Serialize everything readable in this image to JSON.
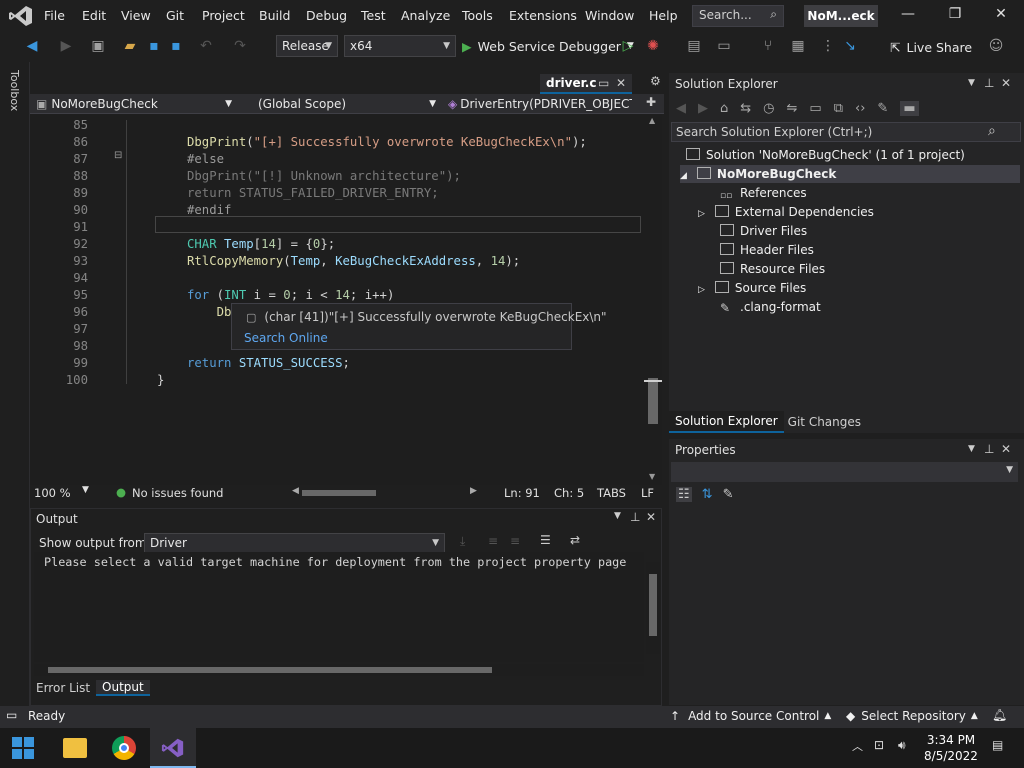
{
  "menu": {
    "items": [
      "File",
      "Edit",
      "View",
      "Git",
      "Project",
      "Build",
      "Debug",
      "Test",
      "Analyze",
      "Tools",
      "Extensions",
      "Window",
      "Help"
    ],
    "search_placeholder": "Search...",
    "title": "NoM...eck"
  },
  "toolbar": {
    "config": "Release",
    "platform": "x64",
    "debugger": "Web Service Debugger",
    "live_share": "Live Share"
  },
  "toolbox": {
    "label": "Toolbox"
  },
  "editor": {
    "tab": "driver.c",
    "project": "NoMoreBugCheck",
    "scope": "(Global Scope)",
    "function": "DriverEntry(PDRIVER_OBJECT Dr",
    "zoom": "100 %",
    "issues": "No issues found",
    "ln": "Ln: 91",
    "ch": "Ch: 5",
    "tabs": "TABS",
    "eol": "LF",
    "lines": [
      {
        "n": "85",
        "t": ""
      },
      {
        "n": "86",
        "t": "DbgPrint(\"[+] Successfully overwrote KeBugCheckEx\\n\");"
      },
      {
        "n": "87",
        "t": "#else"
      },
      {
        "n": "88",
        "t": "DbgPrint(\"[!] Unknown architecture\");"
      },
      {
        "n": "89",
        "t": "return STATUS_FAILED_DRIVER_ENTRY;"
      },
      {
        "n": "90",
        "t": "#endif"
      },
      {
        "n": "91",
        "t": ""
      },
      {
        "n": "92",
        "t": "CHAR Temp[14] = {0};"
      },
      {
        "n": "93",
        "t": "RtlCopyMemory(Temp, KeBugCheckExAddress, 14);"
      },
      {
        "n": "94",
        "t": ""
      },
      {
        "n": "95",
        "t": "for (INT i = 0; i < 14; i++)"
      },
      {
        "n": "96",
        "t": "    DbgPri"
      },
      {
        "n": "97",
        "t": ""
      },
      {
        "n": "98",
        "t": ""
      },
      {
        "n": "99",
        "t": "return STATUS_SUCCESS;"
      },
      {
        "n": "100",
        "t": "}"
      }
    ],
    "tooltip": {
      "text": "(char [41])\"[+] Successfully overwrote KeBugCheckEx\\n\"",
      "link": "Search Online"
    }
  },
  "output": {
    "title": "Output",
    "show_from_label": "Show output from:",
    "source": "Driver",
    "message": "Please select a valid target machine for deployment from the project property page",
    "tabs": [
      "Error List",
      "Output"
    ]
  },
  "solution_explorer": {
    "title": "Solution Explorer",
    "search_placeholder": "Search Solution Explorer (Ctrl+;)",
    "solution": "Solution 'NoMoreBugCheck' (1 of 1 project)",
    "project": "NoMoreBugCheck",
    "items": [
      "References",
      "External Dependencies",
      "Driver Files",
      "Header Files",
      "Resource Files",
      "Source Files",
      ".clang-format"
    ],
    "tabs": [
      "Solution Explorer",
      "Git Changes"
    ]
  },
  "properties": {
    "title": "Properties"
  },
  "statusbar": {
    "ready": "Ready",
    "source_control": "Add to Source Control",
    "repository": "Select Repository"
  },
  "taskbar": {
    "time": "3:34 PM",
    "date": "8/5/2022"
  },
  "colors": {
    "accent": "#0e639c",
    "vs_purple": "#865fc5",
    "keyword": "#569cd6",
    "string": "#d69d85",
    "function": "#dcdcaa"
  }
}
